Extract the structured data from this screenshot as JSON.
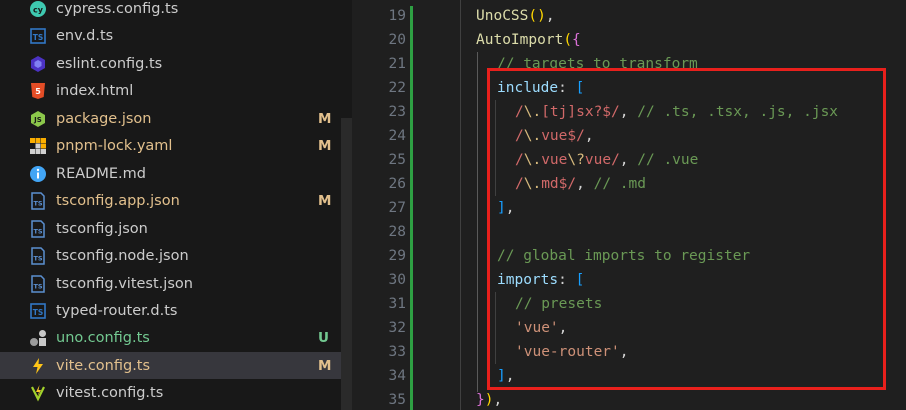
{
  "explorer": {
    "files": [
      {
        "name": "cypress.config.ts",
        "icon": "cypress-icon",
        "status": "",
        "color": "#3ec9b0"
      },
      {
        "name": "env.d.ts",
        "icon": "typescript-def-icon",
        "status": "",
        "color": "#3178c6"
      },
      {
        "name": "eslint.config.ts",
        "icon": "eslint-icon",
        "status": "",
        "color": "#8080f2"
      },
      {
        "name": "index.html",
        "icon": "html-icon",
        "status": "",
        "color": "#e44d26"
      },
      {
        "name": "package.json",
        "icon": "nodejs-icon",
        "status": "M",
        "color": "#8cc84b"
      },
      {
        "name": "pnpm-lock.yaml",
        "icon": "pnpm-icon",
        "status": "M",
        "color": "#f9ad00"
      },
      {
        "name": "README.md",
        "icon": "info-icon",
        "status": "",
        "color": "#42a5f5"
      },
      {
        "name": "tsconfig.app.json",
        "icon": "tsconfig-icon",
        "status": "M",
        "color": "#3178c6"
      },
      {
        "name": "tsconfig.json",
        "icon": "tsconfig-icon",
        "status": "",
        "color": "#3178c6"
      },
      {
        "name": "tsconfig.node.json",
        "icon": "tsconfig-icon",
        "status": "",
        "color": "#3178c6"
      },
      {
        "name": "tsconfig.vitest.json",
        "icon": "tsconfig-icon",
        "status": "",
        "color": "#3178c6"
      },
      {
        "name": "typed-router.d.ts",
        "icon": "typescript-def-icon",
        "status": "",
        "color": "#3178c6"
      },
      {
        "name": "uno.config.ts",
        "icon": "unocss-icon",
        "status": "U",
        "color": "#b0b0b0"
      },
      {
        "name": "vite.config.ts",
        "icon": "vite-icon",
        "status": "M",
        "color": "#ffc517"
      },
      {
        "name": "vitest.config.ts",
        "icon": "vitest-icon",
        "status": "",
        "color": "#a2d22c"
      }
    ]
  },
  "editor": {
    "lines": [
      {
        "num": "19",
        "code": "UnoCSS(),"
      },
      {
        "num": "20",
        "code": "AutoImport({"
      },
      {
        "num": "21",
        "code": "// targets to transform"
      },
      {
        "num": "22",
        "code": "include: ["
      },
      {
        "num": "23",
        "code": "/\\.[tj]sx?$/, // .ts, .tsx, .js, .jsx"
      },
      {
        "num": "24",
        "code": "/\\.vue$/,"
      },
      {
        "num": "25",
        "code": "/\\.vue\\?vue/, // .vue"
      },
      {
        "num": "26",
        "code": "/\\.md$/, // .md"
      },
      {
        "num": "27",
        "code": "],"
      },
      {
        "num": "28",
        "code": ""
      },
      {
        "num": "29",
        "code": "// global imports to register"
      },
      {
        "num": "30",
        "code": "imports: ["
      },
      {
        "num": "31",
        "code": "// presets"
      },
      {
        "num": "32",
        "code": "'vue',"
      },
      {
        "num": "33",
        "code": "'vue-router',"
      },
      {
        "num": "34",
        "code": "],"
      },
      {
        "num": "35",
        "code": "}),"
      }
    ]
  },
  "highlight": {
    "color": "#e8201c"
  }
}
